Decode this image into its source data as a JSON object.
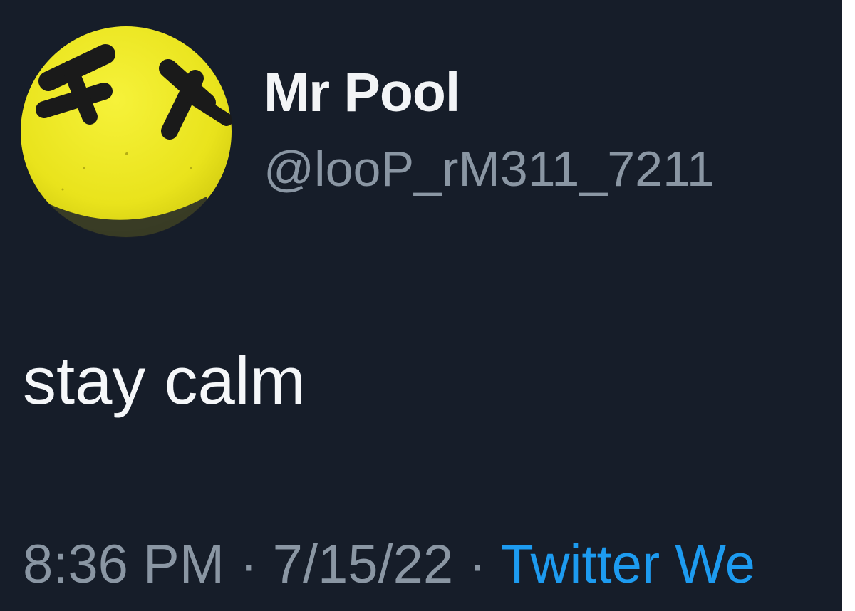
{
  "user": {
    "display_name": "Mr Pool",
    "handle": "@looP_rM311_7211",
    "avatar_icon": "yellow-x-eyes-face-icon"
  },
  "tweet": {
    "text": "stay calm",
    "time": "8:36 PM",
    "date": "7/15/22",
    "separator": "·",
    "source": "Twitter We"
  },
  "colors": {
    "background": "#161d29",
    "avatar_yellow": "#f0ea1f",
    "link_blue": "#1d9bf0",
    "secondary_text": "#8a96a3"
  }
}
